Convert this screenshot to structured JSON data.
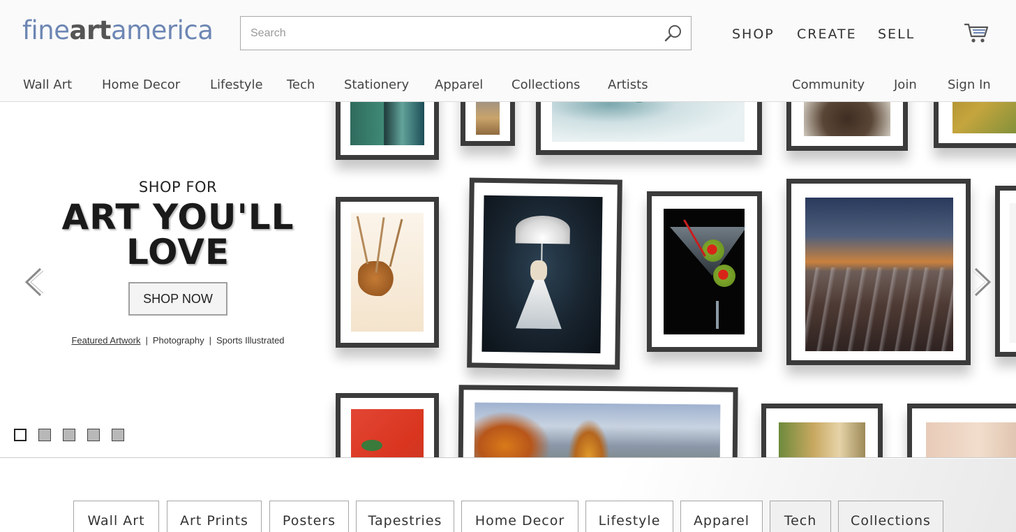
{
  "header": {
    "logo": {
      "part1": "fine",
      "part2": "art",
      "part3": "america"
    },
    "search": {
      "placeholder": "Search",
      "value": ""
    },
    "main_nav": [
      "SHOP",
      "CREATE",
      "SELL"
    ],
    "cart_icon": "cart-icon"
  },
  "subnav": {
    "left": [
      "Wall Art",
      "Home Decor",
      "Lifestyle",
      "Tech",
      "Stationery",
      "Apparel",
      "Collections",
      "Artists"
    ],
    "right": [
      "Community",
      "Join",
      "Sign In"
    ]
  },
  "hero": {
    "kicker": "SHOP FOR",
    "headline_line1": "ART YOU'LL",
    "headline_line2": "LOVE",
    "cta": "SHOP NOW",
    "links": [
      "Featured Artwork",
      "Photography",
      "Sports Illustrated"
    ],
    "separator": "|",
    "slide_count": 5,
    "active_slide": 1,
    "prev_icon": "chevron-left-icon",
    "next_icon": "chevron-right-icon"
  },
  "categories": [
    "Wall Art",
    "Art Prints",
    "Posters",
    "Tapestries",
    "Home Decor",
    "Lifestyle",
    "Apparel",
    "Tech",
    "Collections"
  ],
  "colors": {
    "logo_blue": "#6d87b4",
    "frame": "#3b3b3b",
    "text_dark": "#1a1a1a"
  }
}
